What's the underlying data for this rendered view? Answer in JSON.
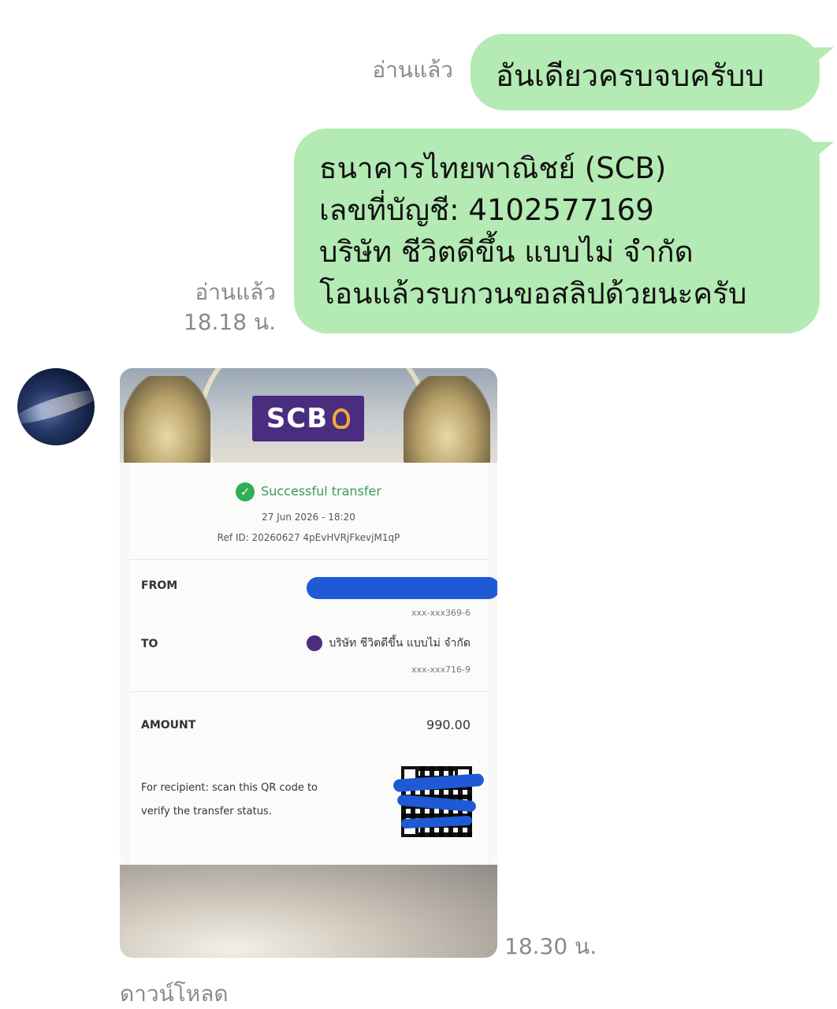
{
  "colors": {
    "bubble": "#b4eab3",
    "meta_text": "#8a8a8a",
    "scb_purple": "#4b2d7f",
    "success_green": "#2fae55"
  },
  "messages": [
    {
      "text_lines": [
        "อันเดียวครบจบครับบ"
      ],
      "read_label": "อ่านแล้ว",
      "time": ""
    },
    {
      "text_lines": [
        "ธนาคารไทยพาณิชย์ (SCB)",
        "เลขที่บัญชี: 4102577169",
        "บริษัท ชีวิตดีขึ้น แบบไม่ จำกัด",
        "โอนแล้วรบกวนขอสลิปด้วยนะครับ"
      ],
      "read_label": "อ่านแล้ว",
      "time": "18.18 น."
    }
  ],
  "incoming": {
    "avatar_icon": "avatar-galaxy",
    "time": "18.30 น.",
    "download_label": "ดาวน์โหลด",
    "receipt": {
      "bank_logo": "SCB",
      "status": "Successful transfer",
      "datetime": "27 Jun 2026 - 18:20",
      "ref": "Ref ID: 20260627 4pEvHVRjFkevjM1qP",
      "from_label": "FROM",
      "from_account": "xxx-xxx369-6",
      "to_label": "TO",
      "to_name": "บริษัท ชีวิตดีขึ้น แบบไม่ จำกัด",
      "to_account": "xxx-xxx716-9",
      "amount_label": "AMOUNT",
      "amount": "990.00",
      "qr_note_1": "For recipient: scan this QR code to",
      "qr_note_2": "verify the transfer status."
    }
  }
}
